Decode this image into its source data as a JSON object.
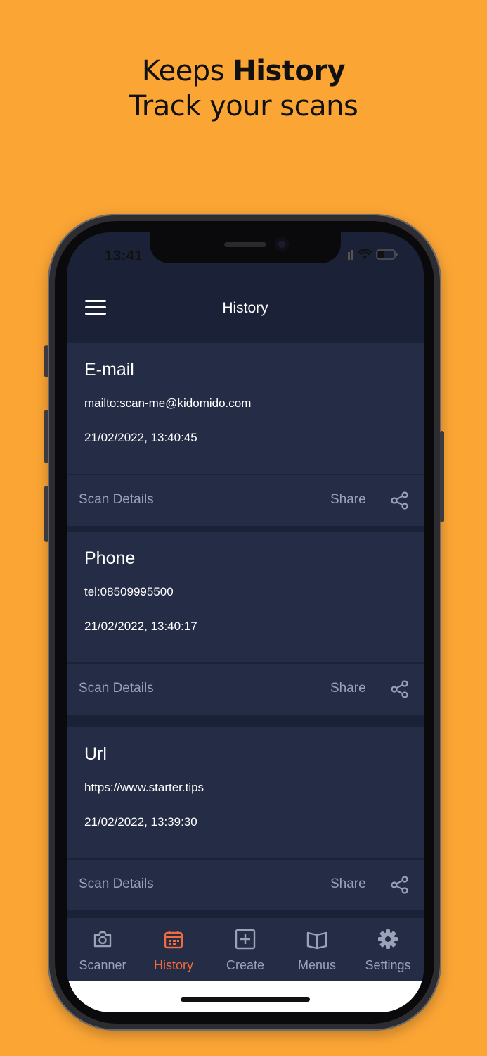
{
  "headline": {
    "prefix": "Keeps ",
    "bold": "History",
    "line2": "Track your scans"
  },
  "status_bar": {
    "time": "13:41"
  },
  "app_bar": {
    "title": "History"
  },
  "history": [
    {
      "type": "E-mail",
      "content": "mailto:scan-me@kidomido.com",
      "date": "21/02/2022, 13:40:45",
      "details_label": "Scan Details",
      "share_label": "Share"
    },
    {
      "type": "Phone",
      "content": "tel:08509995500",
      "date": "21/02/2022, 13:40:17",
      "details_label": "Scan Details",
      "share_label": "Share"
    },
    {
      "type": "Url",
      "content": "https://www.starter.tips",
      "date": "21/02/2022, 13:39:30",
      "details_label": "Scan Details",
      "share_label": "Share"
    }
  ],
  "bottom_nav": [
    {
      "label": "Scanner",
      "icon": "camera-icon",
      "active": false
    },
    {
      "label": "History",
      "icon": "calendar-icon",
      "active": true
    },
    {
      "label": "Create",
      "icon": "plus-square-icon",
      "active": false
    },
    {
      "label": "Menus",
      "icon": "book-icon",
      "active": false
    },
    {
      "label": "Settings",
      "icon": "gear-icon",
      "active": false
    }
  ],
  "colors": {
    "background": "#FBA535",
    "screen": "#1B2237",
    "card": "#252C45",
    "accent": "#F26B3A",
    "muted": "#9aa2b8"
  }
}
